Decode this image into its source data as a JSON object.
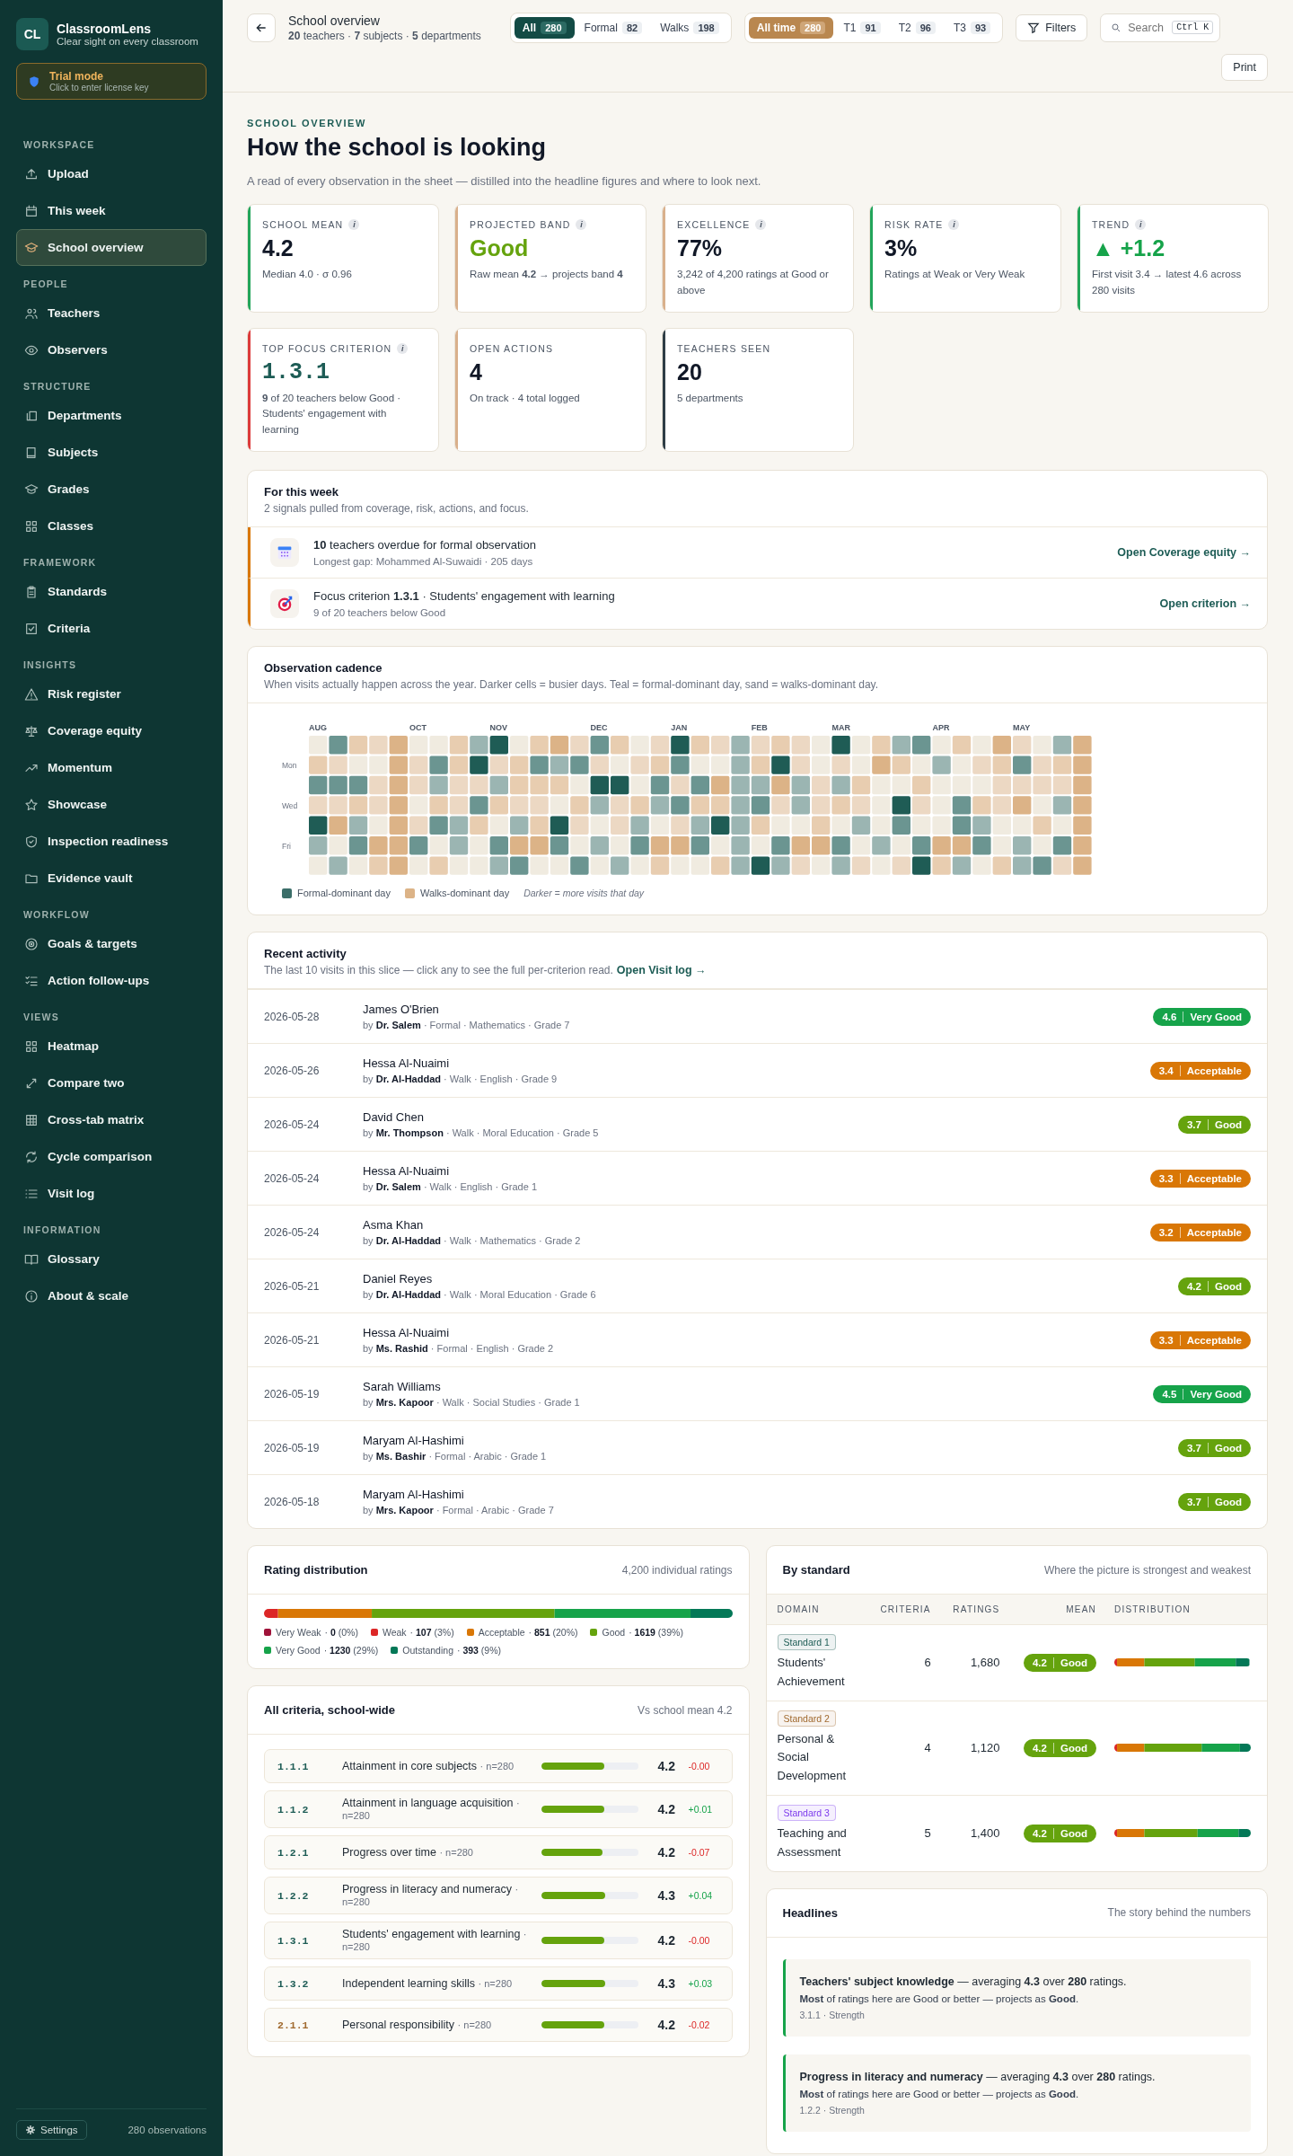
{
  "brand": {
    "logo": "CL",
    "name": "ClassroomLens",
    "tagline": "Clear sight on every classroom"
  },
  "trial": {
    "title": "Trial mode",
    "subtitle": "Click to enter license key"
  },
  "sidebar": {
    "sections": [
      {
        "title": "WORKSPACE",
        "items": [
          {
            "label": "Upload",
            "selected": false
          },
          {
            "label": "This week",
            "selected": false
          },
          {
            "label": "School overview",
            "selected": true
          }
        ]
      },
      {
        "title": "PEOPLE",
        "items": [
          {
            "label": "Teachers",
            "selected": false
          },
          {
            "label": "Observers",
            "selected": false
          }
        ]
      },
      {
        "title": "STRUCTURE",
        "items": [
          {
            "label": "Departments",
            "selected": false
          },
          {
            "label": "Subjects",
            "selected": false
          },
          {
            "label": "Grades",
            "selected": false
          },
          {
            "label": "Classes",
            "selected": false
          }
        ]
      },
      {
        "title": "FRAMEWORK",
        "items": [
          {
            "label": "Standards",
            "selected": false
          },
          {
            "label": "Criteria",
            "selected": false
          }
        ]
      },
      {
        "title": "INSIGHTS",
        "items": [
          {
            "label": "Risk register",
            "selected": false
          },
          {
            "label": "Coverage equity",
            "selected": false
          },
          {
            "label": "Momentum",
            "selected": false
          },
          {
            "label": "Showcase",
            "selected": false
          },
          {
            "label": "Inspection readiness",
            "selected": false
          },
          {
            "label": "Evidence vault",
            "selected": false
          }
        ]
      },
      {
        "title": "WORKFLOW",
        "items": [
          {
            "label": "Goals & targets",
            "selected": false
          },
          {
            "label": "Action follow-ups",
            "selected": false
          }
        ]
      },
      {
        "title": "VIEWS",
        "items": [
          {
            "label": "Heatmap",
            "selected": false
          },
          {
            "label": "Compare two",
            "selected": false
          },
          {
            "label": "Cross-tab matrix",
            "selected": false
          },
          {
            "label": "Cycle comparison",
            "selected": false
          },
          {
            "label": "Visit log",
            "selected": false
          }
        ]
      },
      {
        "title": "INFORMATION",
        "items": [
          {
            "label": "Glossary",
            "selected": false
          },
          {
            "label": "About & scale",
            "selected": false
          }
        ]
      }
    ],
    "footer": {
      "settings": "Settings",
      "count": "280 observations"
    }
  },
  "header": {
    "title": "School overview",
    "subtitle": "**20** teachers · **7** subjects · **5** departments",
    "type_filter": [
      {
        "label": "All",
        "count": "280",
        "selected": true
      },
      {
        "label": "Formal",
        "count": "82",
        "selected": false
      },
      {
        "label": "Walks",
        "count": "198",
        "selected": false
      }
    ],
    "period_filter": [
      {
        "label": "All time",
        "count": "280",
        "selected": true
      },
      {
        "label": "T1",
        "count": "91",
        "selected": false
      },
      {
        "label": "T2",
        "count": "96",
        "selected": false
      },
      {
        "label": "T3",
        "count": "93",
        "selected": false
      }
    ],
    "filters": "Filters",
    "search": {
      "placeholder": "Search",
      "shortcut": "Ctrl K"
    },
    "print": "Print"
  },
  "hero": {
    "eyebrow": "SCHOOL OVERVIEW",
    "title": "How the school is looking",
    "description": "A read of every observation in the sheet — distilled into the headline figures and where to look next."
  },
  "kpis": [
    {
      "label": "SCHOOL MEAN",
      "info": "i",
      "value": "4.2",
      "kind": "plain",
      "sub": "Median 4.0 · σ 0.96",
      "color": "#22a55a"
    },
    {
      "label": "PROJECTED BAND",
      "info": "i",
      "value": "Good",
      "kind": "band",
      "sub": "Raw mean **4.2** → projects band **4**",
      "color": "#d9b08c"
    },
    {
      "label": "EXCELLENCE",
      "info": "i",
      "value": "77%",
      "kind": "plain",
      "sub": "3,242 of 4,200 ratings at Good or above",
      "color": "#d9b08c"
    },
    {
      "label": "RISK RATE",
      "info": "i",
      "value": "3%",
      "kind": "plain",
      "sub": "Ratings at Weak or Very Weak",
      "color": "#22a55a"
    },
    {
      "label": "TREND",
      "info": "i",
      "value": "▲ +1.2",
      "kind": "trend",
      "sub": "First visit 3.4 → latest 4.6 across 280 visits",
      "color": "#22a55a"
    },
    {
      "label": "TOP FOCUS CRITERION",
      "info": "i",
      "value": "1.3.1",
      "kind": "code",
      "sub": "**9** of 20 teachers below Good · Students' engagement with learning",
      "color": "#dc3b3b"
    },
    {
      "label": "OPEN ACTIONS",
      "value": "4",
      "kind": "plain",
      "sub": "On track · 4 total logged",
      "color": "#d9b08c"
    },
    {
      "label": "TEACHERS SEEN",
      "value": "20",
      "kind": "plain",
      "sub": "5 departments",
      "color": "#2f3e46"
    }
  ],
  "week": {
    "title": "For this week",
    "subtitle": "2 signals pulled from coverage, risk, actions, and focus.",
    "signals": [
      {
        "kind": "calendar",
        "title": "**10** teachers overdue for formal observation",
        "sub": "Longest gap: Mohammed Al-Suwaidi · 205 days",
        "link": "Open Coverage equity →"
      },
      {
        "kind": "target",
        "title": "Focus criterion **1.3.1** · Students' engagement with learning",
        "sub": "9 of 20 teachers below Good",
        "link": "Open criterion →"
      }
    ]
  },
  "cadence": {
    "title": "Observation cadence",
    "subtitle": "When visits actually happen across the year. Darker cells = busier days. Teal = formal-dominant day, sand = walks-dominant day.",
    "months": [
      "AUG",
      "OCT",
      "NOV",
      "DEC",
      "JAN",
      "FEB",
      "MAR",
      "APR",
      "MAY"
    ],
    "days": [
      "Mon",
      "Wed",
      "Fri"
    ],
    "legend": {
      "formal": "Formal-dominant day",
      "walks": "Walks-dominant day",
      "note": "Darker = more visits that day"
    }
  },
  "activity": {
    "title": "Recent activity",
    "subtitle": "The last 10 visits in this slice — click any to see the full per-criterion read.",
    "link": "Open Visit log →",
    "rows": [
      {
        "date": "2026-05-28",
        "teacher": "James O'Brien",
        "detail": "by **Dr. Salem** · Formal · Mathematics · Grade 7",
        "score": "4.6",
        "band": "Very Good",
        "color": "#16a34a"
      },
      {
        "date": "2026-05-26",
        "teacher": "Hessa Al-Nuaimi",
        "detail": "by **Dr. Al-Haddad** · Walk · English · Grade 9",
        "score": "3.4",
        "band": "Acceptable",
        "color": "#d97706"
      },
      {
        "date": "2026-05-24",
        "teacher": "David Chen",
        "detail": "by **Mr. Thompson** · Walk · Moral Education · Grade 5",
        "score": "3.7",
        "band": "Good",
        "color": "#65a30d"
      },
      {
        "date": "2026-05-24",
        "teacher": "Hessa Al-Nuaimi",
        "detail": "by **Dr. Salem** · Walk · English · Grade 1",
        "score": "3.3",
        "band": "Acceptable",
        "color": "#d97706"
      },
      {
        "date": "2026-05-24",
        "teacher": "Asma Khan",
        "detail": "by **Dr. Al-Haddad** · Walk · Mathematics · Grade 2",
        "score": "3.2",
        "band": "Acceptable",
        "color": "#d97706"
      },
      {
        "date": "2026-05-21",
        "teacher": "Daniel Reyes",
        "detail": "by **Dr. Al-Haddad** · Walk · Moral Education · Grade 6",
        "score": "4.2",
        "band": "Good",
        "color": "#65a30d"
      },
      {
        "date": "2026-05-21",
        "teacher": "Hessa Al-Nuaimi",
        "detail": "by **Ms. Rashid** · Formal · English · Grade 2",
        "score": "3.3",
        "band": "Acceptable",
        "color": "#d97706"
      },
      {
        "date": "2026-05-19",
        "teacher": "Sarah Williams",
        "detail": "by **Mrs. Kapoor** · Walk · Social Studies · Grade 1",
        "score": "4.5",
        "band": "Very Good",
        "color": "#16a34a"
      },
      {
        "date": "2026-05-19",
        "teacher": "Maryam Al-Hashimi",
        "detail": "by **Ms. Bashir** · Formal · Arabic · Grade 1",
        "score": "3.7",
        "band": "Good",
        "color": "#65a30d"
      },
      {
        "date": "2026-05-18",
        "teacher": "Maryam Al-Hashimi",
        "detail": "by **Mrs. Kapoor** · Formal · Arabic · Grade 7",
        "score": "3.7",
        "band": "Good",
        "color": "#65a30d"
      }
    ]
  },
  "distribution": {
    "title": "Rating distribution",
    "total": "4,200 individual ratings",
    "segments": [
      {
        "label": "Very Weak",
        "detail": "· **0** (0%)",
        "color": "#9f1239"
      },
      {
        "label": "Weak",
        "detail": "· **107** (3%)",
        "color": "#dc2626"
      },
      {
        "label": "Acceptable",
        "detail": "· **851** (20%)",
        "color": "#d97706"
      },
      {
        "label": "Good",
        "detail": "· **1619** (39%)",
        "color": "#65a30d"
      },
      {
        "label": "Very Good",
        "detail": "· **1230** (29%)",
        "color": "#16a34a"
      },
      {
        "label": "Outstanding",
        "detail": "· **393** (9%)",
        "color": "#047857"
      }
    ]
  },
  "criteria": {
    "title": "All criteria, school-wide",
    "note": "Vs school mean 4.2",
    "rows": [
      {
        "code": "1.1.1",
        "name": "Attainment in core subjects",
        "n": "· n=280",
        "level": 0.65,
        "score": "4.2",
        "delta": "-0.00",
        "kind": "down",
        "color": "#1d5c55"
      },
      {
        "code": "1.1.2",
        "name": "Attainment in language acquisition",
        "n": "· n=280",
        "level": 0.65,
        "score": "4.2",
        "delta": "+0.01",
        "kind": "up",
        "color": "#1d5c55"
      },
      {
        "code": "1.2.1",
        "name": "Progress over time",
        "n": "· n=280",
        "level": 0.63,
        "score": "4.2",
        "delta": "-0.07",
        "kind": "down",
        "color": "#1d5c55"
      },
      {
        "code": "1.2.2",
        "name": "Progress in literacy and numeracy",
        "n": "· n=280",
        "level": 0.66,
        "score": "4.3",
        "delta": "+0.04",
        "kind": "up",
        "color": "#1d5c55"
      },
      {
        "code": "1.3.1",
        "name": "Students' engagement with learning",
        "n": "· n=280",
        "level": 0.65,
        "score": "4.2",
        "delta": "-0.00",
        "kind": "down",
        "color": "#1d5c55"
      },
      {
        "code": "1.3.2",
        "name": "Independent learning skills",
        "n": "· n=280",
        "level": 0.66,
        "score": "4.3",
        "delta": "+0.03",
        "kind": "up",
        "color": "#1d5c55"
      },
      {
        "code": "2.1.1",
        "name": "Personal responsibility",
        "n": "· n=280",
        "level": 0.65,
        "score": "4.2",
        "delta": "-0.02",
        "kind": "down",
        "color": "#a0692e"
      }
    ]
  },
  "standards": {
    "title": "By standard",
    "note": "Where the picture is strongest and weakest",
    "columns": [
      "DOMAIN",
      "CRITERIA",
      "RATINGS",
      "MEAN",
      "DISTRIBUTION"
    ],
    "rows": [
      {
        "tag": "Standard 1",
        "color": "#1d5c55",
        "name": "Students' Achievement",
        "criteria": "6",
        "ratings": "1,680",
        "mean": "4.2",
        "band": "Good"
      },
      {
        "tag": "Standard 2",
        "color": "#a0692e",
        "name": "Personal & Social Development",
        "criteria": "4",
        "ratings": "1,120",
        "mean": "4.2",
        "band": "Good"
      },
      {
        "tag": "Standard 3",
        "color": "#7c3aed",
        "name": "Teaching and Assessment",
        "criteria": "5",
        "ratings": "1,400",
        "mean": "4.2",
        "band": "Good"
      }
    ]
  },
  "headlines": {
    "title": "Headlines",
    "note": "The story behind the numbers",
    "items": [
      {
        "title": "**Teachers' subject knowledge** — averaging **4.3** over **280** ratings.",
        "text": "**Most** of ratings here are Good or better — projects as **Good**.",
        "meta": "3.1.1 · Strength"
      },
      {
        "title": "**Progress in literacy and numeracy** — averaging **4.3** over **280** ratings.",
        "text": "**Most** of ratings here are Good or better — projects as **Good**.",
        "meta": "1.2.2 · Strength"
      }
    ]
  }
}
